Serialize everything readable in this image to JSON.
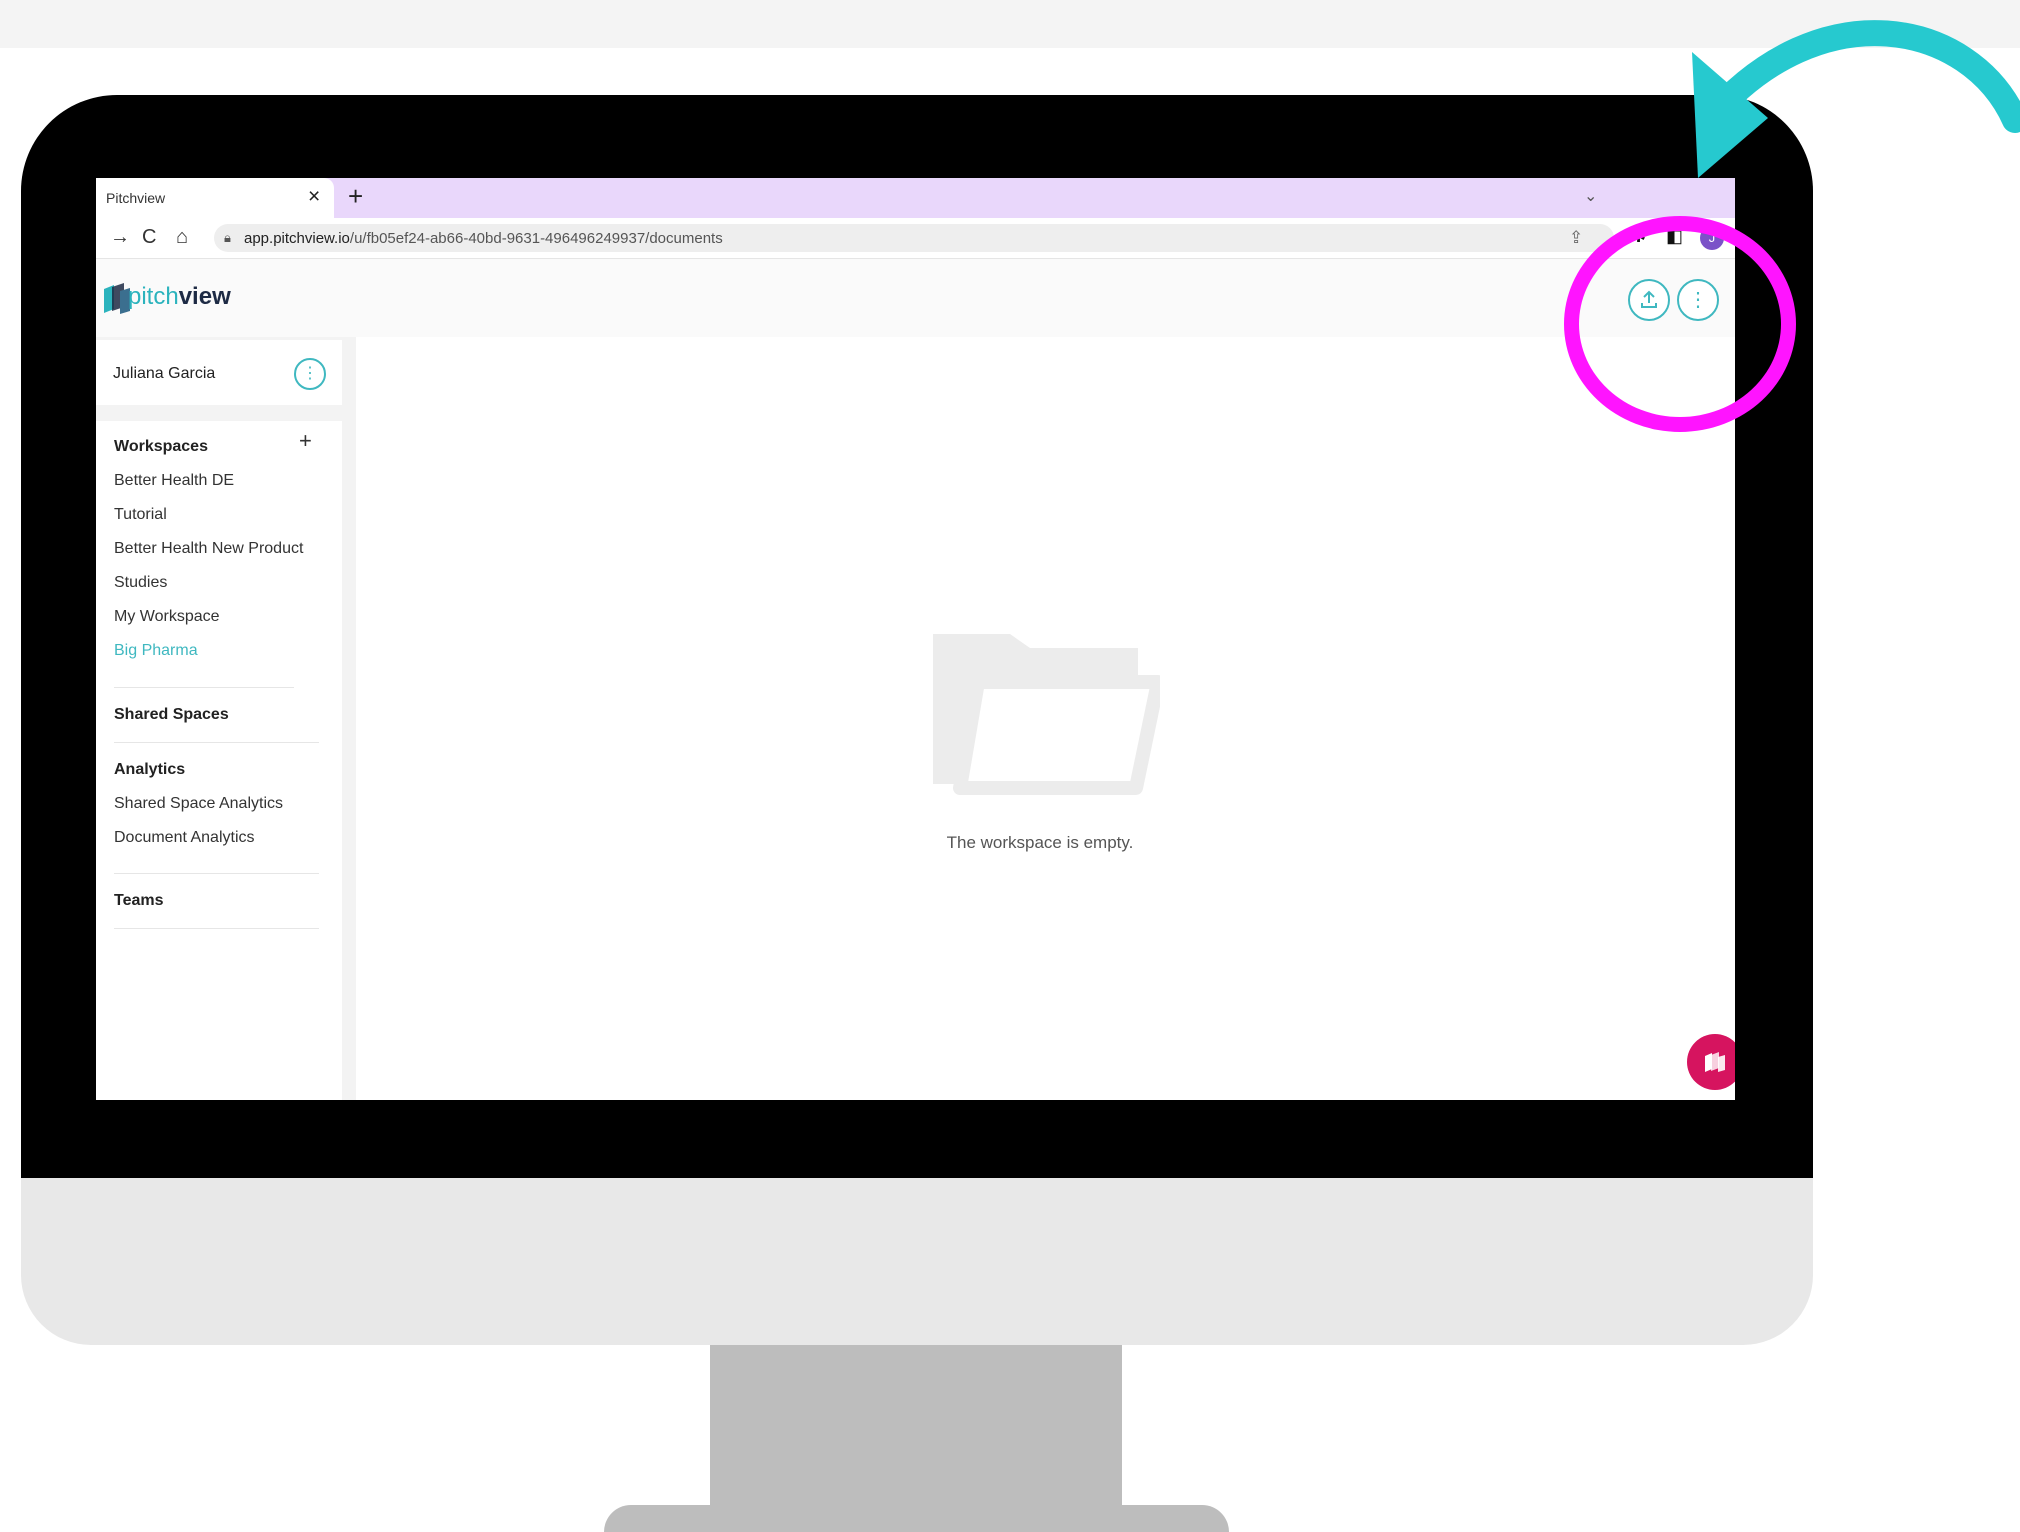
{
  "browser": {
    "tab_title": "Pitchview",
    "tab_close": "×",
    "new_tab": "+",
    "url_host": "app.pitchview.io",
    "url_path": "/u/fb05ef24-ab66-40bd-9631-496496249937/documents",
    "profile_initial": "J"
  },
  "app": {
    "logo_pitch": "pitch",
    "logo_view": "view",
    "user_name": "Juliana Garcia",
    "workspaces": {
      "title": "Workspaces",
      "add": "+",
      "items": [
        "Better Health DE",
        "Tutorial",
        "Better Health New Product",
        "Studies",
        "My Workspace",
        "Big Pharma"
      ],
      "active_index": 5
    },
    "shared_spaces": {
      "title": "Shared Spaces"
    },
    "analytics": {
      "title": "Analytics",
      "items": [
        "Shared Space Analytics",
        "Document Analytics"
      ]
    },
    "teams": {
      "title": "Teams"
    },
    "empty_state": "The workspace is empty."
  },
  "colors": {
    "accent": "#3fb8c0",
    "highlight_circle": "#ff14ff",
    "arrow": "#26c9cf",
    "tabbar": "#e9d7fb",
    "fab": "#d6145f"
  }
}
